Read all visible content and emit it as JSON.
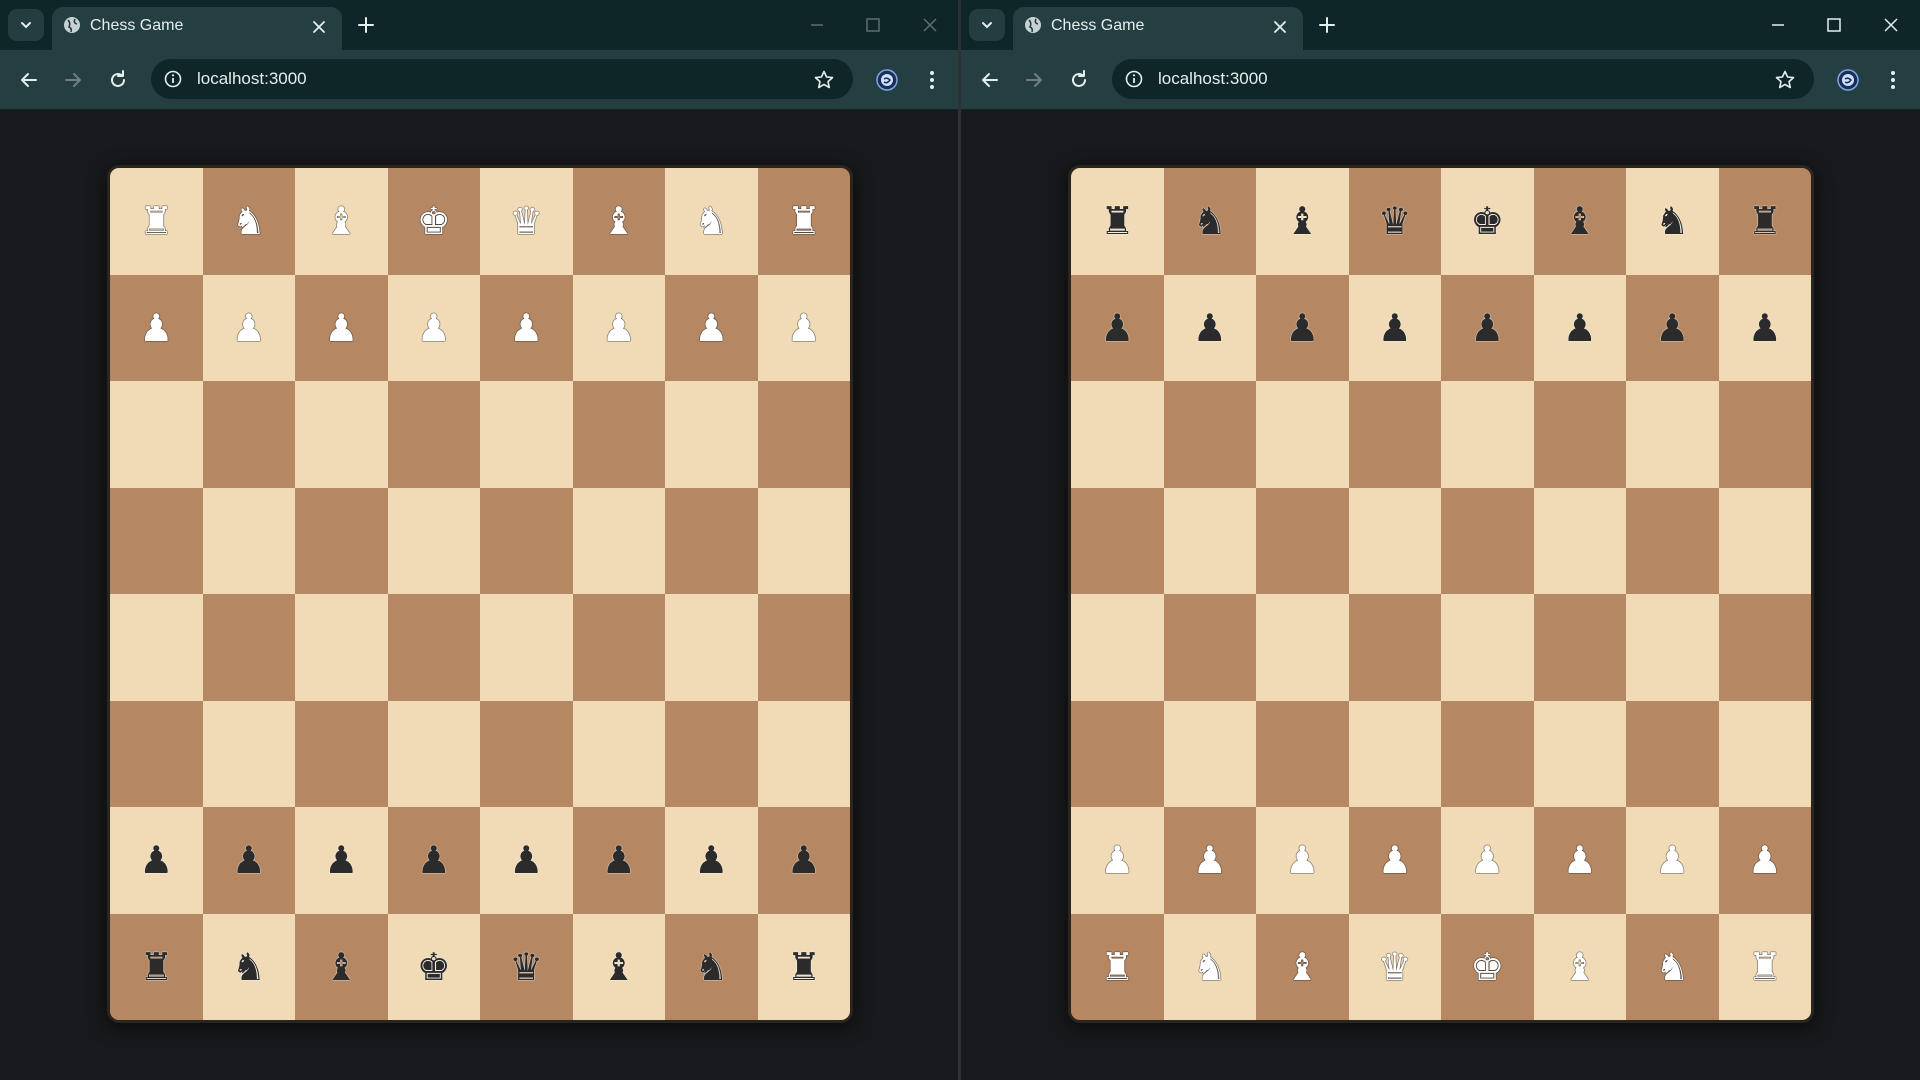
{
  "windows": [
    {
      "id": "left",
      "tab_title": "Chess Game",
      "url": "localhost:3000",
      "board": [
        [
          "R",
          "N",
          "B",
          "K",
          "Q",
          "B",
          "N",
          "R"
        ],
        [
          "P",
          "P",
          "P",
          "P",
          "P",
          "P",
          "P",
          "P"
        ],
        [
          "",
          "",
          "",
          "",
          "",
          "",
          "",
          ""
        ],
        [
          "",
          "",
          "",
          "",
          "",
          "",
          "",
          ""
        ],
        [
          "",
          "",
          "",
          "",
          "",
          "",
          "",
          ""
        ],
        [
          "",
          "",
          "",
          "",
          "",
          "",
          "",
          ""
        ],
        [
          "p",
          "p",
          "p",
          "p",
          "p",
          "p",
          "p",
          "p"
        ],
        [
          "r",
          "n",
          "b",
          "k",
          "q",
          "b",
          "n",
          "r"
        ]
      ]
    },
    {
      "id": "right",
      "tab_title": "Chess Game",
      "url": "localhost:3000",
      "board": [
        [
          "r",
          "n",
          "b",
          "q",
          "k",
          "b",
          "n",
          "r"
        ],
        [
          "p",
          "p",
          "p",
          "p",
          "p",
          "p",
          "p",
          "p"
        ],
        [
          "",
          "",
          "",
          "",
          "",
          "",
          "",
          ""
        ],
        [
          "",
          "",
          "",
          "",
          "",
          "",
          "",
          ""
        ],
        [
          "",
          "",
          "",
          "",
          "",
          "",
          "",
          ""
        ],
        [
          "",
          "",
          "",
          "",
          "",
          "",
          "",
          ""
        ],
        [
          "P",
          "P",
          "P",
          "P",
          "P",
          "P",
          "P",
          "P"
        ],
        [
          "R",
          "N",
          "B",
          "Q",
          "K",
          "B",
          "N",
          "R"
        ]
      ]
    }
  ],
  "colors": {
    "light_square": "#f0dbb6",
    "dark_square": "#b58863",
    "tab_strip": "#0f2628",
    "toolbar": "#243e41",
    "page_background": "#18191c"
  },
  "icons": {
    "tab_search": "chevron-down-icon",
    "favicon": "globe-icon",
    "tab_close": "close-icon",
    "new_tab": "plus-icon",
    "back": "arrow-left-icon",
    "forward": "arrow-right-icon",
    "reload": "reload-icon",
    "site_info": "info-icon",
    "bookmark": "star-icon",
    "extension": "extension-icon",
    "menu": "kebab-menu-icon",
    "minimize": "minimize-icon",
    "maximize": "maximize-icon",
    "close_window": "close-window-icon"
  }
}
